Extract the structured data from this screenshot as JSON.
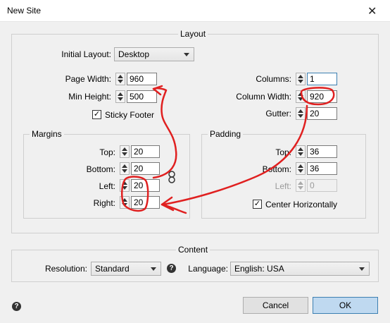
{
  "window": {
    "title": "New Site",
    "close_glyph": "✕"
  },
  "layout": {
    "group_label": "Layout",
    "initial_layout_label": "Initial Layout:",
    "initial_layout_value": "Desktop",
    "page_width_label": "Page Width:",
    "page_width_value": "960",
    "min_height_label": "Min Height:",
    "min_height_value": "500",
    "sticky_footer_label": "Sticky Footer",
    "sticky_footer_checked": true,
    "columns_label": "Columns:",
    "columns_value": "1",
    "column_width_label": "Column Width:",
    "column_width_value": "920",
    "gutter_label": "Gutter:",
    "gutter_value": "20"
  },
  "margins": {
    "group_label": "Margins",
    "top_label": "Top:",
    "top_value": "20",
    "bottom_label": "Bottom:",
    "bottom_value": "20",
    "left_label": "Left:",
    "left_value": "20",
    "right_label": "Right:",
    "right_value": "20",
    "link_icon": "chain-link-icon"
  },
  "padding": {
    "group_label": "Padding",
    "top_label": "Top:",
    "top_value": "36",
    "bottom_label": "Bottom:",
    "bottom_value": "36",
    "left_label": "Left:",
    "left_value": "0",
    "center_horizontally_label": "Center Horizontally",
    "center_horizontally_checked": true
  },
  "content": {
    "group_label": "Content",
    "resolution_label": "Resolution:",
    "resolution_value": "Standard",
    "language_label": "Language:",
    "language_value": "English: USA",
    "help_glyph": "?"
  },
  "footer": {
    "help_glyph": "?",
    "cancel_label": "Cancel",
    "ok_label": "OK"
  },
  "colors": {
    "annotation_red": "#e02020",
    "focus_blue": "#3c7fb1",
    "primary_button": "#bfd9f0"
  }
}
